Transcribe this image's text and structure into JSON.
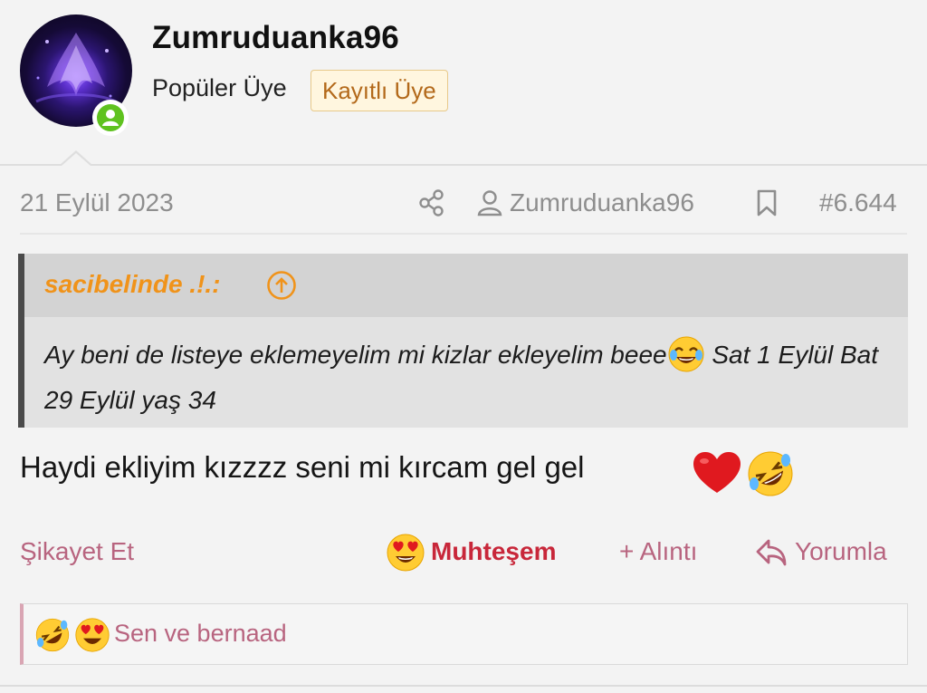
{
  "post": {
    "username": "Zumruduanka96",
    "user_title": "Popüler Üye",
    "user_badge": "Kayıtlı Üye",
    "online_status_icon": "online-user-icon",
    "date": "21 Eylül 2023",
    "author": "Zumruduanka96",
    "post_number": "#6.644",
    "icons": {
      "share": "share-icon",
      "author": "user-icon",
      "bookmark": "bookmark-icon"
    }
  },
  "quote": {
    "author": "sacibelinde .!.:",
    "jump_icon": "arrow-up-circle-icon",
    "text_part1": "Ay beni de listeye eklemeyelim mi kizlar ekleyelim beee",
    "emoji": "joy-emoji",
    "text_part2": " Sat 1 Eylül Bat 29 Eylül yaş 34"
  },
  "message": {
    "text": "Haydi ekliyim kızzzz seni mi kırcam gel gel ",
    "emojis": [
      "red-heart-emoji",
      "rofl-emoji"
    ]
  },
  "actions": {
    "report": "Şikayet Et",
    "reaction_label": "Muhteşem",
    "reaction_emoji": "heart-eyes-emoji",
    "quote": "+ Alıntı",
    "reply": "Yorumla"
  },
  "reactions": {
    "emojis": [
      "rofl-emoji",
      "heart-eyes-emoji"
    ],
    "text": "Sen ve bernaad"
  },
  "colors": {
    "accent": "#b8647f",
    "reaction_red": "#c8273a",
    "quote_author": "#f0931a",
    "badge_text": "#b3691a",
    "online_green": "#5fc21f"
  }
}
